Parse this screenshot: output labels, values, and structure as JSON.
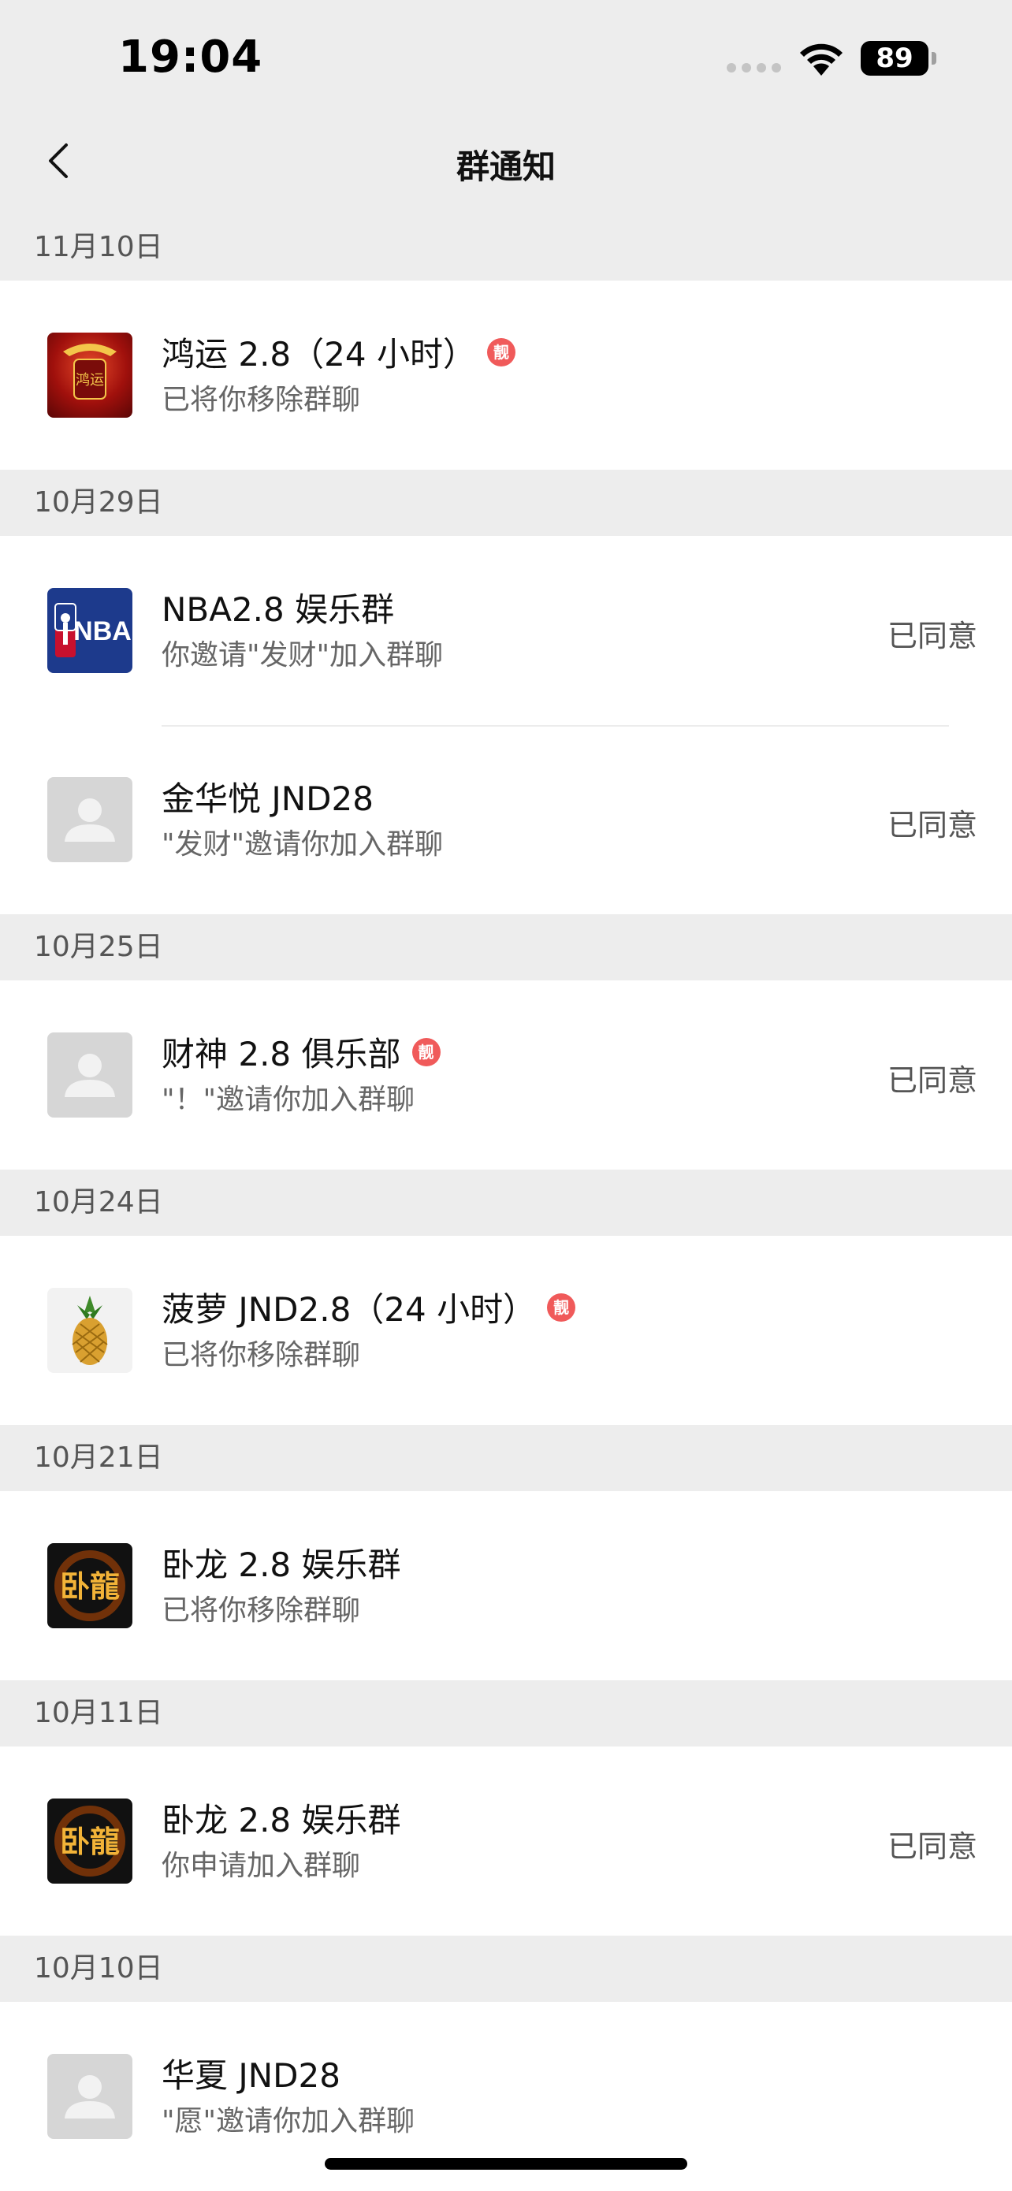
{
  "status_bar": {
    "time": "19:04",
    "battery": "89"
  },
  "nav": {
    "title": "群通知"
  },
  "groups": [
    {
      "date": "11月10日",
      "items": [
        {
          "title": "鸿运 2.8（24 小时）",
          "subtitle": "已将你移除群聊",
          "status": "",
          "badge": "靓",
          "avatar": "hongyun-avatar"
        }
      ]
    },
    {
      "date": "10月29日",
      "items": [
        {
          "title": "NBA2.8 娱乐群",
          "subtitle": "你邀请\"发财\"加入群聊",
          "status": "已同意",
          "badge": "",
          "avatar": "nba-logo-avatar"
        },
        {
          "title": "金华悦 JND28",
          "subtitle": "\"发财\"邀请你加入群聊",
          "status": "已同意",
          "badge": "",
          "avatar": "default-avatar"
        }
      ]
    },
    {
      "date": "10月25日",
      "items": [
        {
          "title": "财神 2.8 俱乐部",
          "subtitle": "\"！\"邀请你加入群聊",
          "status": "已同意",
          "badge": "靓",
          "avatar": "default-avatar"
        }
      ]
    },
    {
      "date": "10月24日",
      "items": [
        {
          "title": "菠萝 JND2.8（24 小时）",
          "subtitle": "已将你移除群聊",
          "status": "",
          "badge": "靓",
          "avatar": "pineapple-avatar"
        }
      ]
    },
    {
      "date": "10月21日",
      "items": [
        {
          "title": "卧龙 2.8 娱乐群",
          "subtitle": "已将你移除群聊",
          "status": "",
          "badge": "",
          "avatar": "wolong-avatar"
        }
      ]
    },
    {
      "date": "10月11日",
      "items": [
        {
          "title": "卧龙 2.8 娱乐群",
          "subtitle": "你申请加入群聊",
          "status": "已同意",
          "badge": "",
          "avatar": "wolong-avatar"
        }
      ]
    },
    {
      "date": "10月10日",
      "items": [
        {
          "title": "华夏 JND28",
          "subtitle": "\"愿\"邀请你加入群聊",
          "status": "",
          "badge": "",
          "avatar": "default-avatar"
        }
      ]
    }
  ],
  "avatar_text": {
    "nba": "NBA",
    "wolong": "卧龍",
    "hongyun": "鸿运"
  },
  "colors": {
    "background": "#EDEDED",
    "card": "#FFFFFF",
    "badge": "#F05A5A",
    "secondary_text": "#666666"
  }
}
